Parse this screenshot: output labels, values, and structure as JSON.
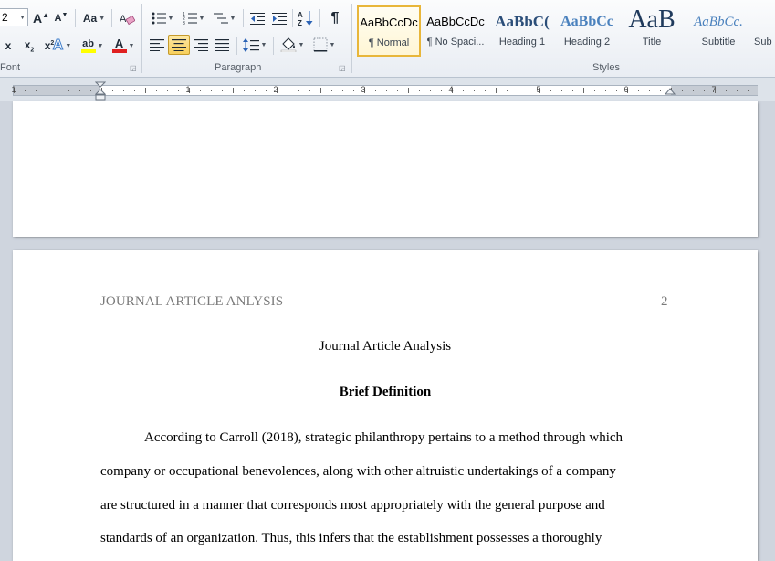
{
  "ribbon": {
    "font_group": {
      "label": "Font",
      "font_size": "2",
      "grow_font_icon": "A",
      "shrink_font_icon": "A",
      "change_case_label": "Aa",
      "subscript_label": "x",
      "superscript_label": "x",
      "highlight_label": "ab",
      "font_color_label": "A",
      "text_effects_label": "A",
      "bold_partial": "x"
    },
    "paragraph_group": {
      "label": "Paragraph",
      "pilcrow": "¶",
      "sort_label": "A Z"
    },
    "styles_group": {
      "label": "Styles",
      "items": [
        {
          "sample": "AaBbCcDc",
          "name": "¶ Normal",
          "active": true
        },
        {
          "sample": "AaBbCcDc",
          "name": "¶ No Spaci...",
          "active": false
        },
        {
          "sample": "AaBbC(",
          "name": "Heading 1",
          "active": false
        },
        {
          "sample": "AaBbCc",
          "name": "Heading 2",
          "active": false
        },
        {
          "sample": "AaB",
          "name": "Title",
          "active": false
        },
        {
          "sample": "AaBbCc.",
          "name": "Subtitle",
          "active": false
        },
        {
          "sample": "",
          "name": "Sub",
          "active": false
        }
      ]
    },
    "accent_colors": {
      "highlight": "#ffff00",
      "font_color": "#e02020",
      "selected": "#f7cf5c"
    }
  },
  "ruler": {
    "numbers": [
      "1",
      "1",
      "2",
      "3",
      "4",
      "5",
      "6",
      "7"
    ]
  },
  "document": {
    "header_text": "JOURNAL ARTICLE ANLYSIS",
    "page_number": "2",
    "title": "Journal Article Analysis",
    "heading": "Brief Definition",
    "lines": [
      "According to Carroll (2018), strategic philanthropy pertains to a method through which",
      "company or occupational benevolences, along with other altruistic undertakings of a company",
      "are structured in a manner that corresponds most appropriately with the general purpose and",
      "standards of an organization. Thus, this infers that the establishment possesses a thoroughly"
    ]
  }
}
